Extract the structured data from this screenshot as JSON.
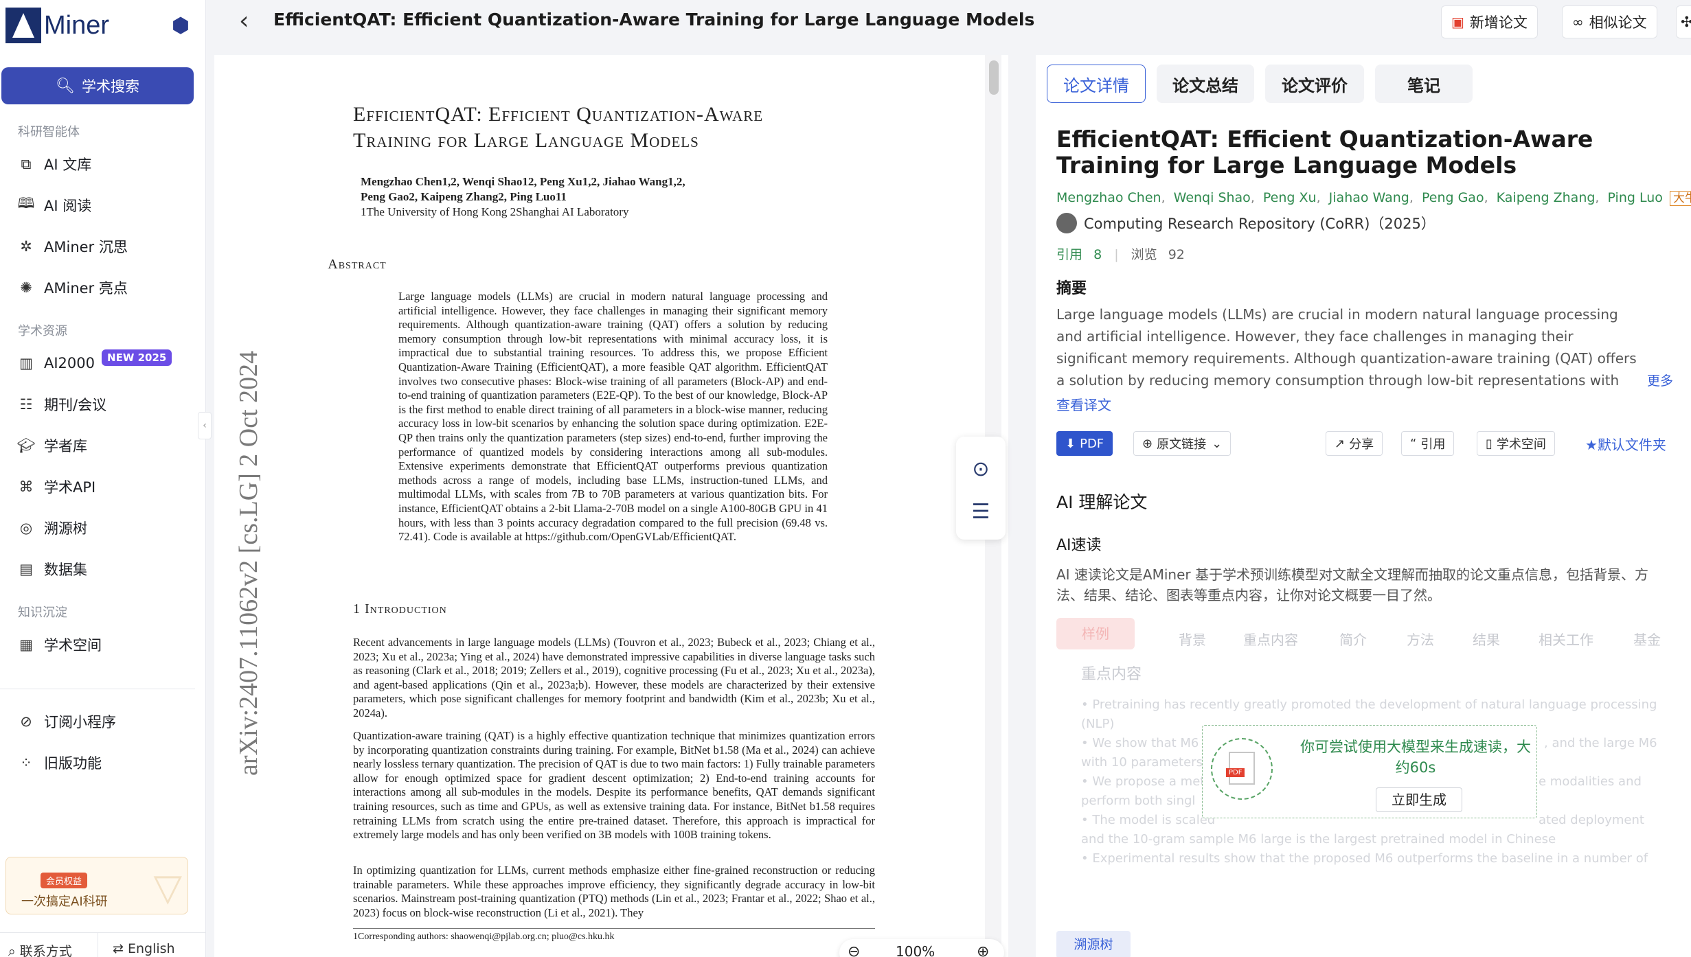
{
  "app": {
    "logo": "Miner"
  },
  "sidebar": {
    "search_label": "学术搜索",
    "section1": "科研智能体",
    "section2": "学术资源",
    "section3": "知识沉淀",
    "items": [
      {
        "label": "AI 文库",
        "icon": "library-icon"
      },
      {
        "label": "AI 阅读",
        "icon": "book-icon"
      },
      {
        "label": "AMiner 沉思",
        "icon": "think-icon"
      },
      {
        "label": "AMiner 亮点",
        "icon": "highlight-icon"
      },
      {
        "label": "AI2000",
        "icon": "chart-icon",
        "badge": "NEW 2025"
      },
      {
        "label": "期刊/会议",
        "icon": "journal-icon"
      },
      {
        "label": "学者库",
        "icon": "scholar-icon"
      },
      {
        "label": "学术API",
        "icon": "api-icon"
      },
      {
        "label": "溯源树",
        "icon": "tree-icon"
      },
      {
        "label": "数据集",
        "icon": "dataset-icon"
      },
      {
        "label": "学术空间",
        "icon": "space-icon"
      },
      {
        "label": "订阅小程序",
        "icon": "subscribe-icon"
      },
      {
        "label": "旧版功能",
        "icon": "legacy-icon"
      }
    ],
    "promo": {
      "badge": "会员权益",
      "text": "一次搞定AI科研"
    },
    "bottom": {
      "contact": "联系方式",
      "lang": "English"
    }
  },
  "header": {
    "title": "EfficientQAT: Efficient Quantization-Aware Training for Large Language Models",
    "add_paper": "新增论文",
    "similar": "相似论文"
  },
  "pdf": {
    "title_line1": "EfficientQAT: Efficient Quantization-Aware",
    "title_line2": "Training for Large Language Models",
    "authors_line1": "Mengzhao Chen1,2, Wenqi Shao12, Peng Xu1,2, Jiahao Wang1,2,",
    "authors_line2": "Peng Gao2, Kaipeng Zhang2, Ping Luo11",
    "affil": "1The University of Hong Kong 2Shanghai AI Laboratory",
    "abstract_head": "Abstract",
    "abstract": "Large language models (LLMs) are crucial in modern natural language processing and artificial intelligence. However, they face challenges in managing their significant memory requirements. Although quantization-aware training (QAT) offers a solution by reducing memory consumption through low-bit representations with minimal accuracy loss, it is impractical due to substantial training resources. To address this, we propose Efficient Quantization-Aware Training (EfficientQAT), a more feasible QAT algorithm. EfficientQAT involves two consecutive phases: Block-wise training of all parameters (Block-AP) and end-to-end training of quantization parameters (E2E-QP). To the best of our knowledge, Block-AP is the first method to enable direct training of all parameters in a block-wise manner, reducing accuracy loss in low-bit scenarios by enhancing the solution space during optimization. E2E-QP then trains only the quantization parameters (step sizes) end-to-end, further improving the performance of quantized models by considering interactions among all sub-modules. Extensive experiments demonstrate that EfficientQAT outperforms previous quantization methods across a range of models, including base LLMs, instruction-tuned LLMs, and multimodal LLMs, with scales from 7B to 70B parameters at various quantization bits. For instance, EfficientQAT obtains a 2-bit Llama-2-70B model on a single A100-80GB GPU in 41 hours, with less than 3 points accuracy degradation compared to the full precision (69.48 vs. 72.41). Code is available at https://github.com/OpenGVLab/EfficientQAT.",
    "section": "1   Introduction",
    "para1": "Recent advancements in large language models (LLMs) (Touvron et al., 2023; Bubeck et al., 2023; Chiang et al., 2023; Xu et al., 2023a; Ying et al., 2024) have demonstrated impressive capabilities in diverse language tasks such as reasoning (Clark et al., 2018; 2019; Zellers et al., 2019), cognitive processing (Fu et al., 2023; Xu et al., 2023a), and agent-based applications (Qin et al., 2023a;b). However, these models are characterized by their extensive parameters, which pose significant challenges for memory footprint and bandwidth (Kim et al., 2023b; Xu et al., 2024a).",
    "para2": "Quantization-aware training (QAT) is a highly effective quantization technique that minimizes quantization errors by incorporating quantization constraints during training. For example, BitNet b1.58 (Ma et al., 2024) can achieve nearly lossless ternary quantization. The precision of QAT is due to two main factors: 1) Fully trainable parameters allow for enough optimized space for gradient descent optimization; 2) End-to-end training accounts for interactions among all sub-modules in the models. Despite its performance benefits, QAT demands significant training resources, such as time and GPUs, as well as extensive training data. For instance, BitNet b1.58 requires retraining LLMs from scratch using the entire pre-trained dataset. Therefore, this approach is impractical for extremely large models and has only been verified on 3B models with 100B training tokens.",
    "para3": "In optimizing quantization for LLMs, current methods emphasize either fine-grained reconstruction or reducing trainable parameters. While these approaches improve efficiency, they significantly degrade accuracy in low-bit scenarios. Mainstream post-training quantization (PTQ) methods (Lin et al., 2023; Frantar et al., 2022; Shao et al., 2023) focus on block-wise reconstruction (Li et al., 2021). They",
    "footnote": "1Corresponding authors: shaowenqi@pjlab.org.cn; pluo@cs.hku.hk",
    "arxiv": "arXiv:2407.11062v2  [cs.LG]  2 Oct 2024",
    "zoom": "100%"
  },
  "info": {
    "tabs": [
      "论文详情",
      "论文总结",
      "论文评价",
      "笔记"
    ],
    "title": "EfficientQAT: Efficient Quantization-Aware Training for Large Language Models",
    "authors": [
      "Mengzhao Chen",
      "Wenqi Shao",
      "Peng Xu",
      "Jiahao Wang",
      "Peng Gao",
      "Kaipeng Zhang",
      "Ping Luo"
    ],
    "scholar_tag": "大牛学者",
    "venue": "Computing Research Repository (CoRR)（2025）",
    "cite_label": "引用",
    "cite_count": "8",
    "view_label": "浏览",
    "view_count": "92",
    "abstract_head": "摘要",
    "abstract": "Large language models (LLMs) are crucial in modern natural language processing and artificial intelligence. However, they face challenges in managing their significant memory requirements. Although quantization-aware training (QAT) offers a solution by reducing memory consumption through low-bit representations with minimal accuracy loss, it is impractical due to substanti",
    "more": "更多",
    "translate": "查看译文",
    "buttons": {
      "pdf": "PDF",
      "source": "原文链接",
      "share": "分享",
      "cite": "引用",
      "space": "学术空间",
      "folder": "默认文件夹"
    },
    "ai_head": "AI 理解论文",
    "ai_sub": "AI速读",
    "ai_desc": "AI 速读论文是AMiner 基于学术预训练模型对文献全文理解而抽取的论文重点信息，包括背景、方法、结果、结论、图表等重点内容，让你对论文概要一目了然。",
    "sample_tab": "样例",
    "cat_tabs": [
      "背景",
      "重点内容",
      "简介",
      "方法",
      "结果",
      "相关工作",
      "基金"
    ],
    "fade_head": "重点内容",
    "fade_lines": [
      "• Pretraining has recently greatly promoted the development of natural language processing",
      "(NLP)",
      "• We show that M6 ou",
      "with 10 parameters",
      "• We propose a meth",
      "perform both singl",
      "• The model is scaled",
      "and the 10-gram sample M6 large is the largest pretrained model in Chinese",
      "• Experimental results show that the proposed M6 outperforms the baseline in a number of"
    ],
    "fade_right": [
      ", and the large M6",
      "e modalities and",
      "ated deployment"
    ],
    "gen_text": "你可尝试使用大模型来生成速读，大约60s",
    "gen_btn": "立即生成",
    "trace_tab": "溯源树"
  }
}
